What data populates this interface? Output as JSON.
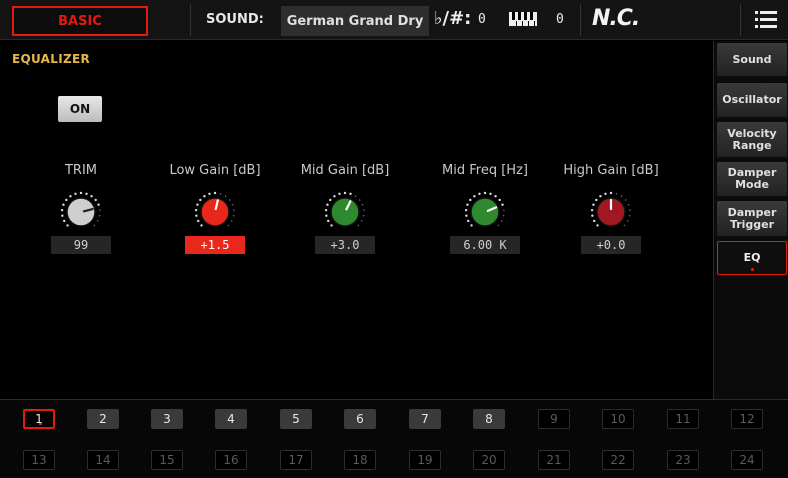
{
  "topbar": {
    "mode": "BASIC",
    "sound_label": "SOUND:",
    "sound_name": "German Grand Dry",
    "transpose_symbol": "♭/#:",
    "transpose_value": "0",
    "octave_value": "0",
    "chord": "N.C."
  },
  "equalizer": {
    "title": "EQUALIZER",
    "on_label": "ON",
    "knobs": [
      {
        "label": "TRIM",
        "value": "99",
        "color": "#cfcfcf",
        "level": 0.78
      },
      {
        "label": "Low Gain [dB]",
        "value": "+1.5",
        "color": "#e8281a",
        "level": 0.55
      },
      {
        "label": "Mid Gain [dB]",
        "value": "+3.0",
        "color": "#2f8a2f",
        "level": 0.6
      },
      {
        "label": "Mid Freq [Hz]",
        "value": "6.00 K",
        "color": "#2f8a2f",
        "level": 0.75
      },
      {
        "label": "High Gain [dB]",
        "value": "+0.0",
        "color": "#a01822",
        "level": 0.5
      }
    ]
  },
  "side_tabs": [
    {
      "label": "Sound"
    },
    {
      "label": "Oscillator"
    },
    {
      "label": "Velocity Range"
    },
    {
      "label": "Damper Mode"
    },
    {
      "label": "Damper Trigger"
    },
    {
      "label": "EQ"
    }
  ],
  "pages": {
    "row1": [
      "1",
      "2",
      "3",
      "4",
      "5",
      "6",
      "7",
      "8",
      "9",
      "10",
      "11",
      "12"
    ],
    "row2": [
      "13",
      "14",
      "15",
      "16",
      "17",
      "18",
      "19",
      "20",
      "21",
      "22",
      "23",
      "24"
    ]
  },
  "colors": {
    "accent": "#e21b12",
    "title": "#e6b84a"
  }
}
